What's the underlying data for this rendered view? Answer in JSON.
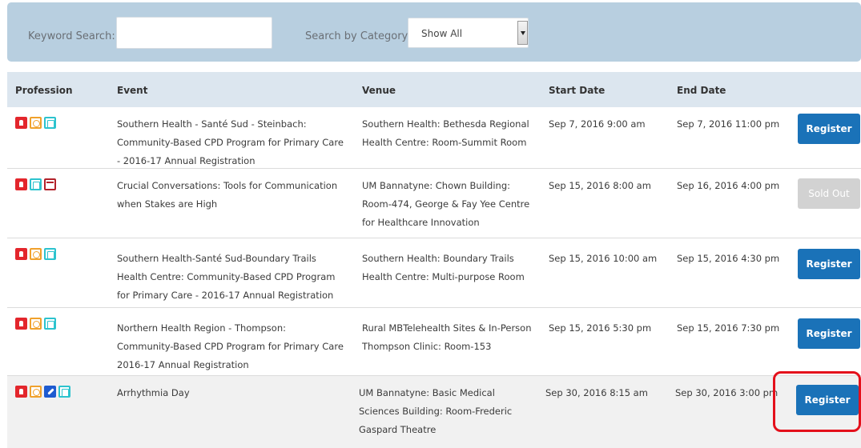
{
  "search": {
    "keyword_label": "Keyword Search:",
    "keyword_value": "",
    "category_label": "Search by Category:",
    "category_selected": "Show All"
  },
  "table": {
    "columns": [
      "Profession",
      "Event",
      "Venue",
      "Start Date",
      "End Date"
    ],
    "rows": [
      {
        "icons": [
          "red-doctor-icon",
          "orange-person-icon",
          "cyan-clipboard-icon"
        ],
        "event": [
          "Southern Health - Santé Sud - Steinbach:",
          "Community-Based CPD Program for Primary Care",
          "- 2016-17 Annual Registration"
        ],
        "venue": [
          "Southern Health: Bethesda Regional",
          "Health Centre: Room-Summit Room"
        ],
        "start": "Sep 7, 2016 9:00 am",
        "end": "Sep 7, 2016 11:00 pm",
        "action": "Register"
      },
      {
        "icons": [
          "red-doctor-icon",
          "cyan-clipboard-icon",
          "maroon-institution-icon"
        ],
        "event": [
          "Crucial Conversations: Tools for Communication",
          "when Stakes are High"
        ],
        "venue": [
          "UM Bannatyne: Chown Building:",
          "Room-474, George & Fay Yee Centre",
          "for Healthcare Innovation"
        ],
        "start": "Sep 15, 2016 8:00 am",
        "end": "Sep 16, 2016 4:00 pm",
        "action": "Sold Out"
      },
      {
        "icons": [
          "red-doctor-icon",
          "orange-person-icon",
          "cyan-clipboard-icon"
        ],
        "event": [
          "Southern Health-Santé Sud-Boundary Trails",
          "Health Centre: Community-Based CPD Program",
          "for Primary Care - 2016-17 Annual Registration"
        ],
        "venue": [
          "Southern Health: Boundary Trails",
          "Health Centre: Multi-purpose Room"
        ],
        "start": "Sep 15, 2016 10:00 am",
        "end": "Sep 15, 2016 4:30 pm",
        "action": "Register"
      },
      {
        "icons": [
          "red-doctor-icon",
          "orange-person-icon",
          "cyan-clipboard-icon"
        ],
        "event": [
          "Northern Health Region - Thompson:",
          "Community-Based CPD Program for Primary Care",
          "2016-17 Annual Registration"
        ],
        "venue": [
          "Rural MBTelehealth Sites & In-Person",
          "Thompson Clinic: Room-153"
        ],
        "start": "Sep 15, 2016 5:30 pm",
        "end": "Sep 15, 2016 7:30 pm",
        "action": "Register"
      },
      {
        "icons": [
          "red-doctor-icon",
          "orange-person-icon",
          "blue-pill-icon",
          "cyan-clipboard-icon"
        ],
        "event": [
          "Arrhythmia Day"
        ],
        "venue": [
          "UM Bannatyne: Basic Medical",
          "Sciences Building: Room-Frederic",
          "Gaspard Theatre"
        ],
        "start": "Sep 30, 2016 8:15 am",
        "end": "Sep 30, 2016 3:00 pm",
        "action": "Register"
      }
    ]
  },
  "colors": {
    "search_bar": "#b8cfe0",
    "header": "#dce6ef",
    "register_button": "#1a72b8",
    "sold_out_button": "#d2d2d2",
    "highlight_outline": "#e4101b"
  }
}
